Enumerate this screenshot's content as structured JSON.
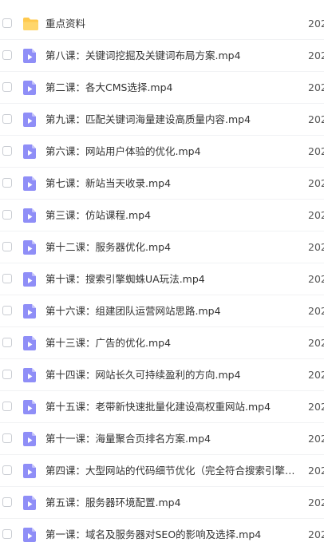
{
  "colors": {
    "folder_icon": "#ffc94d",
    "video_icon": "#8f8ef7",
    "text": "#333333",
    "date_text": "#555555"
  },
  "files": [
    {
      "name": "重点资料",
      "type": "folder",
      "icon": "folder-icon",
      "date": "202"
    },
    {
      "name": "第八课：关键词挖掘及关键词布局方案.mp4",
      "type": "video",
      "icon": "video-file-icon",
      "date": "202"
    },
    {
      "name": "第二课：各大CMS选择.mp4",
      "type": "video",
      "icon": "video-file-icon",
      "date": "202"
    },
    {
      "name": "第九课：匹配关键词海量建设高质量内容.mp4",
      "type": "video",
      "icon": "video-file-icon",
      "date": "202"
    },
    {
      "name": "第六课：网站用户体验的优化.mp4",
      "type": "video",
      "icon": "video-file-icon",
      "date": "202"
    },
    {
      "name": "第七课：新站当天收录.mp4",
      "type": "video",
      "icon": "video-file-icon",
      "date": "202"
    },
    {
      "name": "第三课：仿站课程.mp4",
      "type": "video",
      "icon": "video-file-icon",
      "date": "202"
    },
    {
      "name": "第十二课：服务器优化.mp4",
      "type": "video",
      "icon": "video-file-icon",
      "date": "202"
    },
    {
      "name": "第十课：搜索引擎蜘蛛UA玩法.mp4",
      "type": "video",
      "icon": "video-file-icon",
      "date": "202"
    },
    {
      "name": "第十六课：组建团队运营网站思路.mp4",
      "type": "video",
      "icon": "video-file-icon",
      "date": "202"
    },
    {
      "name": "第十三课：广告的优化.mp4",
      "type": "video",
      "icon": "video-file-icon",
      "date": "202"
    },
    {
      "name": "第十四课：网站长久可持续盈利的方向.mp4",
      "type": "video",
      "icon": "video-file-icon",
      "date": "202"
    },
    {
      "name": "第十五课：老带新快速批量化建设高权重网站.mp4",
      "type": "video",
      "icon": "video-file-icon",
      "date": "202"
    },
    {
      "name": "第十一课：海量聚合页排名方案.mp4",
      "type": "video",
      "icon": "video-file-icon",
      "date": "202"
    },
    {
      "name": "第四课：大型网站的代码细节优化（完全符合搜索引擎优…",
      "type": "video",
      "icon": "video-file-icon",
      "date": "202"
    },
    {
      "name": "第五课：服务器环境配置.mp4",
      "type": "video",
      "icon": "video-file-icon",
      "date": "202"
    },
    {
      "name": "第一课：域名及服务器对SEO的影响及选择.mp4",
      "type": "video",
      "icon": "video-file-icon",
      "date": "202"
    }
  ]
}
